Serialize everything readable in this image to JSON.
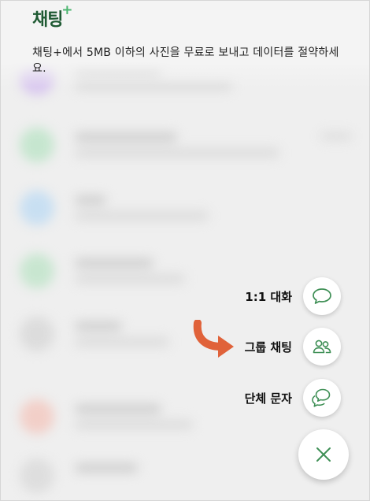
{
  "header": {
    "title": "채팅",
    "title_plus": "+",
    "promo_text": "채팅+에서 5MB 이하의 사진을 무료로 보내고 데이터를 절약하세요."
  },
  "fab_menu": {
    "items": [
      {
        "label": "1:1 대화",
        "icon": "speech-bubble-icon"
      },
      {
        "label": "그룹 채팅",
        "icon": "group-people-icon"
      },
      {
        "label": "단체 문자",
        "icon": "double-bubble-icon"
      }
    ],
    "close_icon": "close-icon"
  },
  "colors": {
    "brand_green": "#1f5a33",
    "accent_green": "#4bb56f",
    "icon_green": "#3e8f55",
    "arrow_orange": "#e0623a"
  }
}
